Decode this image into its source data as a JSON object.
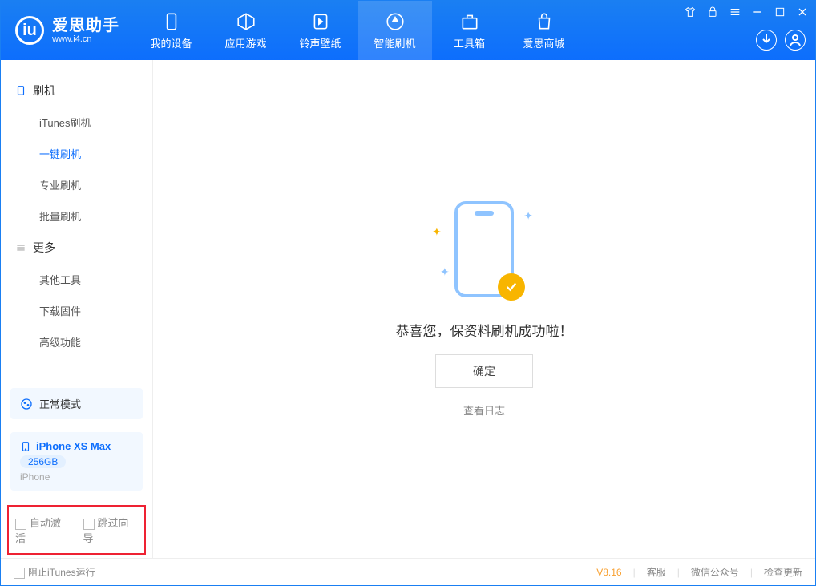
{
  "app": {
    "name": "爱思助手",
    "url": "www.i4.cn"
  },
  "tabs": [
    "我的设备",
    "应用游戏",
    "铃声壁纸",
    "智能刷机",
    "工具箱",
    "爱思商城"
  ],
  "activeTabIndex": 3,
  "sidebar": {
    "cat1": "刷机",
    "items1": [
      "iTunes刷机",
      "一键刷机",
      "专业刷机",
      "批量刷机"
    ],
    "active1": 1,
    "cat2": "更多",
    "items2": [
      "其他工具",
      "下载固件",
      "高级功能"
    ]
  },
  "mode": {
    "label": "正常模式"
  },
  "device": {
    "name": "iPhone XS Max",
    "capacity": "256GB",
    "type": "iPhone"
  },
  "options": {
    "opt1": "自动激活",
    "opt2": "跳过向导"
  },
  "main": {
    "message": "恭喜您，保资料刷机成功啦！",
    "confirm": "确定",
    "loglink": "查看日志"
  },
  "footer": {
    "blockItunes": "阻止iTunes运行",
    "version": "V8.16",
    "links": [
      "客服",
      "微信公众号",
      "检查更新"
    ]
  }
}
